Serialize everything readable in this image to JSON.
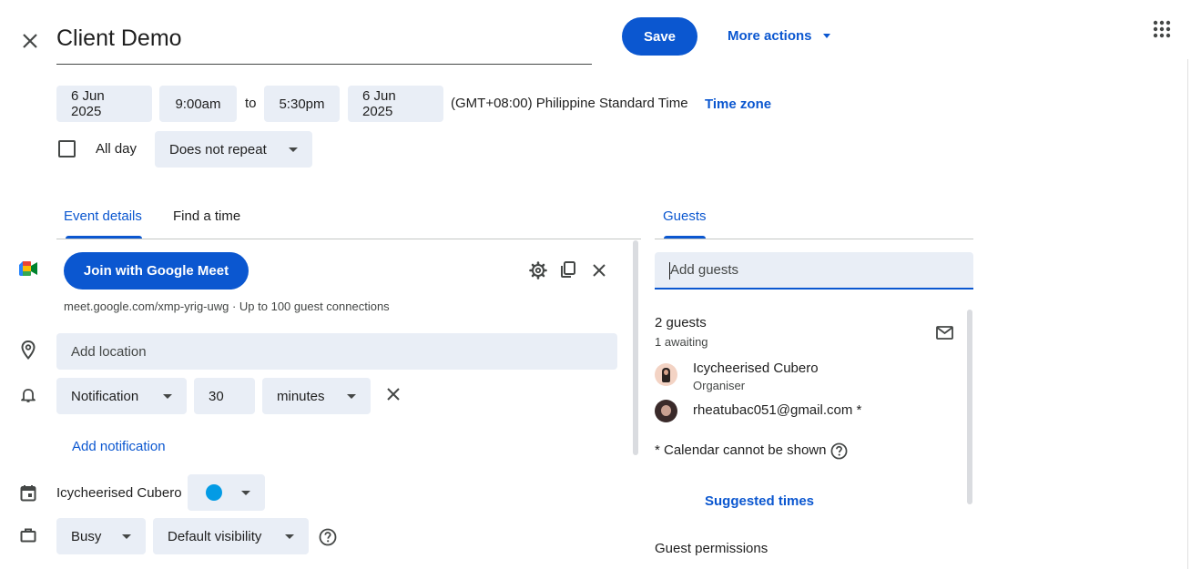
{
  "header": {
    "title": "Client Demo",
    "save_label": "Save",
    "more_actions_label": "More actions"
  },
  "datetime": {
    "start_date": "6 Jun 2025",
    "start_time": "9:00am",
    "to_label": "to",
    "end_time": "5:30pm",
    "end_date": "6 Jun 2025",
    "timezone_text": "(GMT+08:00) Philippine Standard Time",
    "timezone_link": "Time zone",
    "all_day_label": "All day",
    "repeat_value": "Does not repeat"
  },
  "tabs": [
    {
      "label": "Event details",
      "active": true
    },
    {
      "label": "Find a time",
      "active": false
    }
  ],
  "meet": {
    "join_label": "Join with Google Meet",
    "info": "meet.google.com/xmp-yrig-uwg · Up to 100 guest connections"
  },
  "location": {
    "placeholder": "Add location"
  },
  "notification": {
    "type": "Notification",
    "amount": "30",
    "unit": "minutes",
    "add_label": "Add notification"
  },
  "calendar": {
    "owner": "Icycheerised Cubero",
    "color": "#039be5"
  },
  "status": {
    "busy": "Busy",
    "visibility": "Default visibility"
  },
  "guests": {
    "tab_label": "Guests",
    "input_placeholder": "Add guests",
    "count": "2 guests",
    "awaiting": "1 awaiting",
    "list": [
      {
        "name": "Icycheerised Cubero",
        "role": "Organiser"
      },
      {
        "name": "rheatubac051@gmail.com *",
        "role": ""
      }
    ],
    "calendar_note": "* Calendar cannot be shown",
    "suggested_times": "Suggested times",
    "permissions_label": "Guest permissions"
  },
  "colors": {
    "accent": "#0b57d0",
    "field_bg": "#e9eef6"
  }
}
